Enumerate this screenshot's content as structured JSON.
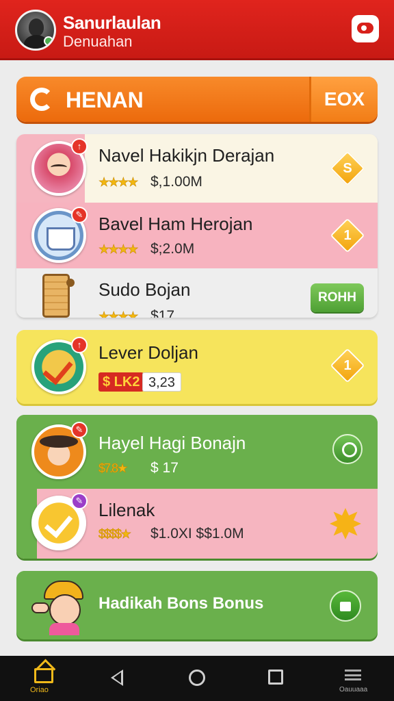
{
  "app": {
    "title": "Sanurlaulan",
    "subtitle": "Denuahan",
    "header_icon": "chat-bubble-icon"
  },
  "tab": {
    "label": "HENAN",
    "button": "EOX"
  },
  "list": [
    {
      "title": "Navel Hakikjn Derajan",
      "stars": "★★★★",
      "price": "$,1.00M",
      "badge": "↑",
      "action": "S"
    },
    {
      "title": "Bavel Ham Herojan",
      "stars": "★★★★",
      "price": "$;2.0M",
      "badge": "✎",
      "action": "1"
    },
    {
      "title": "Sudo Bojan",
      "stars": "★★★★",
      "price": "$17",
      "action": "ROHH"
    }
  ],
  "featured": {
    "title": "Lever Doljan",
    "tag_red": "$ LK2",
    "tag_white": "3,23",
    "badge": "↑",
    "action": "1"
  },
  "group": [
    {
      "title": "Hayel Hagi Bonajn",
      "stars": "$7.8★",
      "price": "$ 17",
      "badge": "✎"
    },
    {
      "title": "Lilenak",
      "stars": "$$$$★",
      "price": "$1.0XI $$1.0M",
      "badge": "✎"
    }
  ],
  "bonus": {
    "title": "Hadikah Bons Bonus"
  },
  "navbar": {
    "home_label": "Oriao",
    "more_label": "Oauuaaa"
  },
  "colors": {
    "header": "#d8201a",
    "tab": "#f07818",
    "yellow_card": "#f6e45c",
    "green_card": "#6ab04c",
    "pink_row": "#f7b3bf"
  }
}
